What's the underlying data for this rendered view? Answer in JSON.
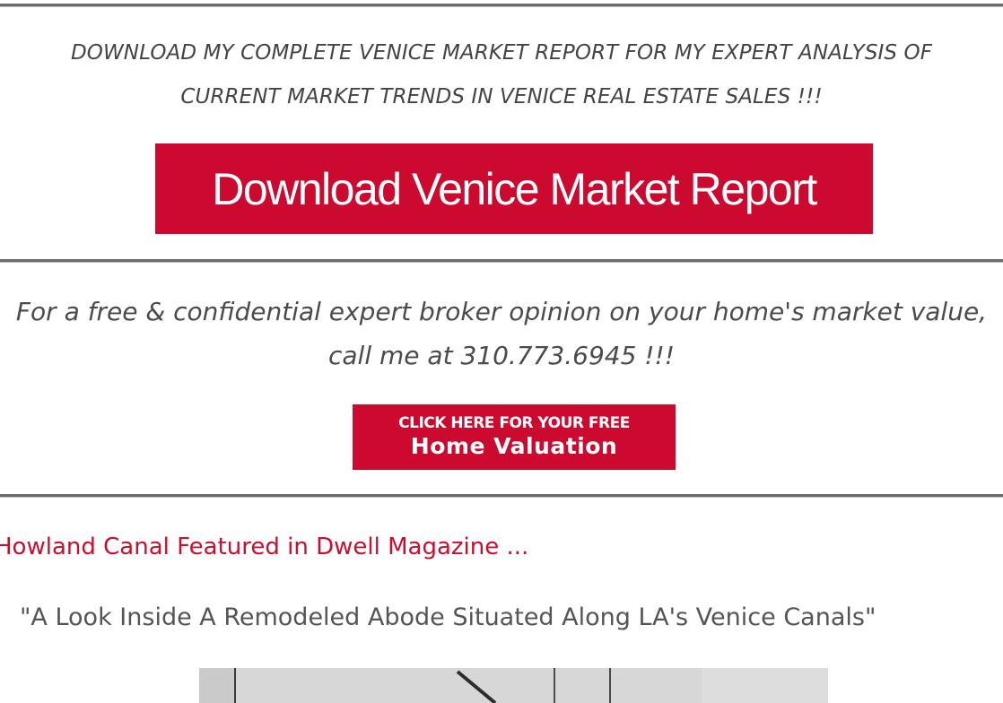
{
  "report_section": {
    "text_line1": "DOWNLOAD MY COMPLETE VENICE MARKET REPORT FOR MY EXPERT ANALYSIS OF",
    "text_line2": "CURRENT MARKET TRENDS IN VENICE REAL ESTATE SALES !!!",
    "button_label": "Download Venice Market Report"
  },
  "valuation_section": {
    "text_line1": "For a free & confidential expert broker opinion on your home's market value,",
    "text_line2": "call me at 310.773.6945 !!!",
    "button_small": "CLICK HERE FOR YOUR FREE",
    "button_big": "Home Valuation"
  },
  "article": {
    "title": "Howland Canal Featured in Dwell Magazine ...",
    "quote": "\"A Look Inside A Remodeled Abode Situated Along LA's Venice Canals\""
  },
  "colors": {
    "accent_red": "#cc0a2f",
    "rule_gray": "#6b6b6b"
  }
}
